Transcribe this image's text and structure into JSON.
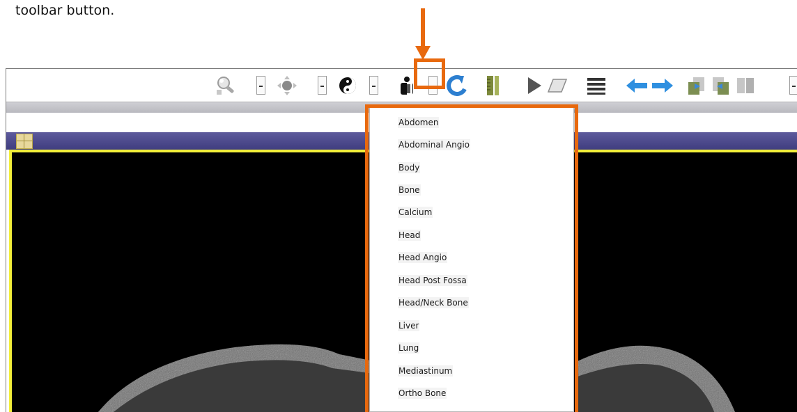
{
  "caption": "toolbar button.",
  "dropdown": {
    "items": [
      {
        "label": "Abdomen"
      },
      {
        "label": "Abdominal Angio"
      },
      {
        "label": "Body"
      },
      {
        "label": "Bone"
      },
      {
        "label": "Calcium"
      },
      {
        "label": "Head"
      },
      {
        "label": "Head Angio"
      },
      {
        "label": "Head Post Fossa"
      },
      {
        "label": "Head/Neck Bone"
      },
      {
        "label": "Liver"
      },
      {
        "label": "Lung"
      },
      {
        "label": "Mediastinum"
      },
      {
        "label": "Ortho Bone"
      }
    ]
  },
  "toolbar": {
    "icons": [
      "zoom-icon",
      "pan-icon",
      "invert-icon",
      "window-level-preset-icon",
      "rotate-icon",
      "ruler-icon",
      "cine-play-icon",
      "eraser-icon",
      "stack-icon",
      "previous-arrow-icon",
      "next-arrow-icon",
      "series-left-icon",
      "series-right-icon",
      "series-grid-icon"
    ]
  },
  "colors": {
    "annotation": "#e8690e",
    "viewport_border": "#f2ef3a",
    "header_bar": "#4a4789",
    "arrow_blue": "#2e8fe0"
  }
}
